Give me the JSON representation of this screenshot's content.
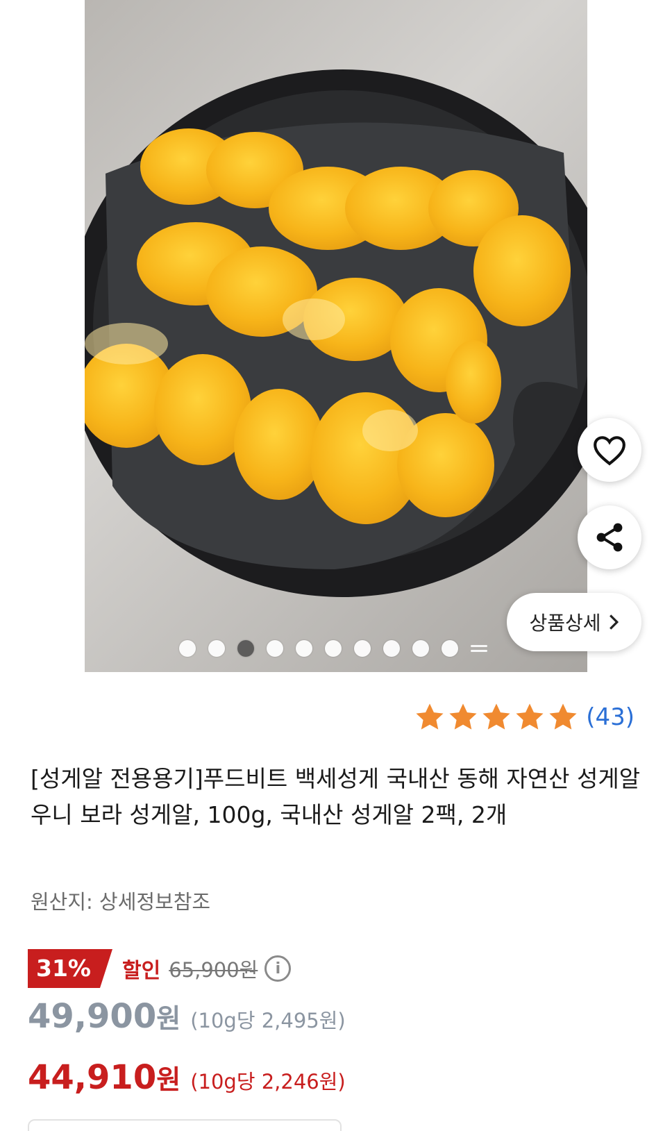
{
  "gallery": {
    "image_alt": "product photo: sea urchin roe in black round container",
    "dot_count": 10,
    "active_index": 2
  },
  "actions": {
    "like_icon": "heart-icon",
    "share_icon": "share-icon",
    "detail_label": "상품상세",
    "detail_chevron": "›"
  },
  "rating": {
    "stars": 5,
    "count": "(43)",
    "star_color": "#f08a30"
  },
  "product": {
    "title": "[성게알 전용용기]푸드비트 백세성게 국내산 동해 자연산 성게알 우니 보라 성게알, 100g, 국내산 성게알 2팩, 2개",
    "origin": "원산지: 상세정보참조"
  },
  "price": {
    "discount_rate": "31%",
    "discount_label": "할인",
    "original_price": "65,900원",
    "sale_price": "49,900",
    "sale_won": "원",
    "sale_unit": "(10g당 2,495원)",
    "final_price": "44,910",
    "final_won": "원",
    "final_unit": "(10g당 2,246원)",
    "accent_color": "#c81e1e"
  }
}
